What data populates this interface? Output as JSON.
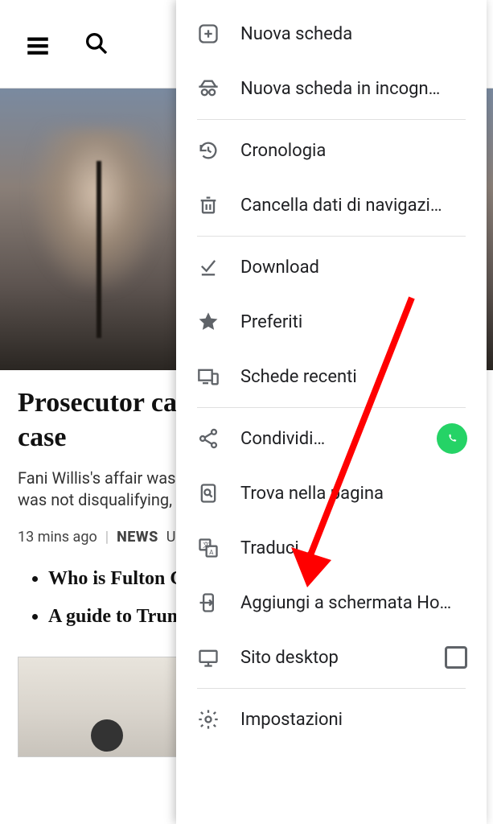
{
  "page": {
    "headline": "Prosecutor can stay on Trump Georgia case",
    "summary": "Fani Willis's affair was a \"tremendous lapse in judgement\" but was not disqualifying, the judge rules.",
    "timestamp": "13 mins ago",
    "category": "NEWS",
    "region_partial": "U",
    "bullets": [
      "Who is Fulton County DA Fani Willis?",
      "A guide to Trump's Georgia case"
    ]
  },
  "menu": {
    "items": [
      {
        "id": "new-tab",
        "label": "Nuova scheda",
        "icon": "plus-box"
      },
      {
        "id": "incognito",
        "label": "Nuova scheda in incogn…",
        "icon": "incognito"
      },
      {
        "divider": true
      },
      {
        "id": "history",
        "label": "Cronologia",
        "icon": "history"
      },
      {
        "id": "clear-data",
        "label": "Cancella dati di navigazi…",
        "icon": "trash"
      },
      {
        "divider": true
      },
      {
        "id": "downloads",
        "label": "Download",
        "icon": "download-done"
      },
      {
        "id": "bookmarks",
        "label": "Preferiti",
        "icon": "star"
      },
      {
        "id": "recent-tabs",
        "label": "Schede recenti",
        "icon": "devices"
      },
      {
        "divider": true
      },
      {
        "id": "share",
        "label": "Condividi…",
        "icon": "share",
        "rightBadge": "whatsapp"
      },
      {
        "id": "find",
        "label": "Trova nella pagina",
        "icon": "find-in-page"
      },
      {
        "id": "translate",
        "label": "Traduci…",
        "icon": "translate"
      },
      {
        "id": "add-home",
        "label": "Aggiungi a schermata Ho…",
        "icon": "add-to-home"
      },
      {
        "id": "desktop-site",
        "label": "Sito desktop",
        "icon": "desktop",
        "rightBadge": "checkbox"
      },
      {
        "divider": true
      },
      {
        "id": "settings",
        "label": "Impostazioni",
        "icon": "gear"
      }
    ]
  }
}
